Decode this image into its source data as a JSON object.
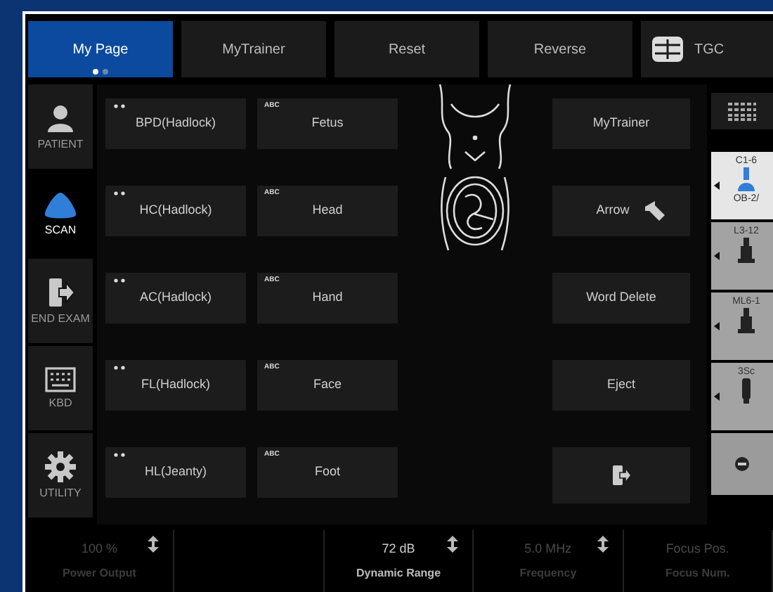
{
  "top_tabs": [
    {
      "label": "My Page",
      "selected": true
    },
    {
      "label": "MyTrainer",
      "selected": false
    },
    {
      "label": "Reset",
      "selected": false
    },
    {
      "label": "Reverse",
      "selected": false
    }
  ],
  "page_dots": [
    {
      "selected": true
    },
    {
      "selected": false
    }
  ],
  "tgc": {
    "label": "TGC"
  },
  "sidebar": [
    {
      "label": "PATIENT",
      "kind": "patient",
      "selected": false
    },
    {
      "label": "SCAN",
      "kind": "scan",
      "selected": true
    },
    {
      "label": "END EXAM",
      "kind": "end-exam",
      "selected": false
    },
    {
      "label": "KBD",
      "kind": "keyboard",
      "selected": false
    },
    {
      "label": "UTILITY",
      "kind": "utility",
      "selected": false
    }
  ],
  "measure_buttons": [
    {
      "label": "BPD(Hadlock)"
    },
    {
      "label": "HC(Hadlock)"
    },
    {
      "label": "AC(Hadlock)"
    },
    {
      "label": "FL(Hadlock)"
    },
    {
      "label": "HL(Jeanty)"
    }
  ],
  "annotation_buttons": [
    {
      "tag": "ABC",
      "label": "Fetus"
    },
    {
      "tag": "ABC",
      "label": "Head"
    },
    {
      "tag": "ABC",
      "label": "Hand"
    },
    {
      "tag": "ABC",
      "label": "Face"
    },
    {
      "tag": "ABC",
      "label": "Foot"
    }
  ],
  "action_buttons": [
    {
      "kind": "text",
      "label": "MyTrainer"
    },
    {
      "kind": "arrow",
      "label": "Arrow"
    },
    {
      "kind": "text",
      "label": "Word Delete"
    },
    {
      "kind": "text",
      "label": "Eject"
    },
    {
      "kind": "exit"
    }
  ],
  "probes": [
    {
      "kind": "convex",
      "name": "C1-6",
      "preset": "OB-2/",
      "selected": true
    },
    {
      "kind": "linear",
      "name": "L3-12",
      "selected": false
    },
    {
      "kind": "linear",
      "name": "ML6-1",
      "selected": false
    },
    {
      "kind": "phased",
      "name": "3Sc",
      "selected": false
    },
    {
      "kind": "minus"
    }
  ],
  "bottom_controls": [
    {
      "value": "100 %",
      "label": "Power Output",
      "disabled": true
    },
    {
      "value": "72 dB",
      "label": "Dynamic Range",
      "disabled": false
    },
    {
      "value": "5.0 MHz",
      "label": "Frequency",
      "disabled": true
    },
    {
      "value": "Focus Pos.",
      "label": "Focus Num.",
      "disabled": true,
      "kind": "plain"
    }
  ]
}
